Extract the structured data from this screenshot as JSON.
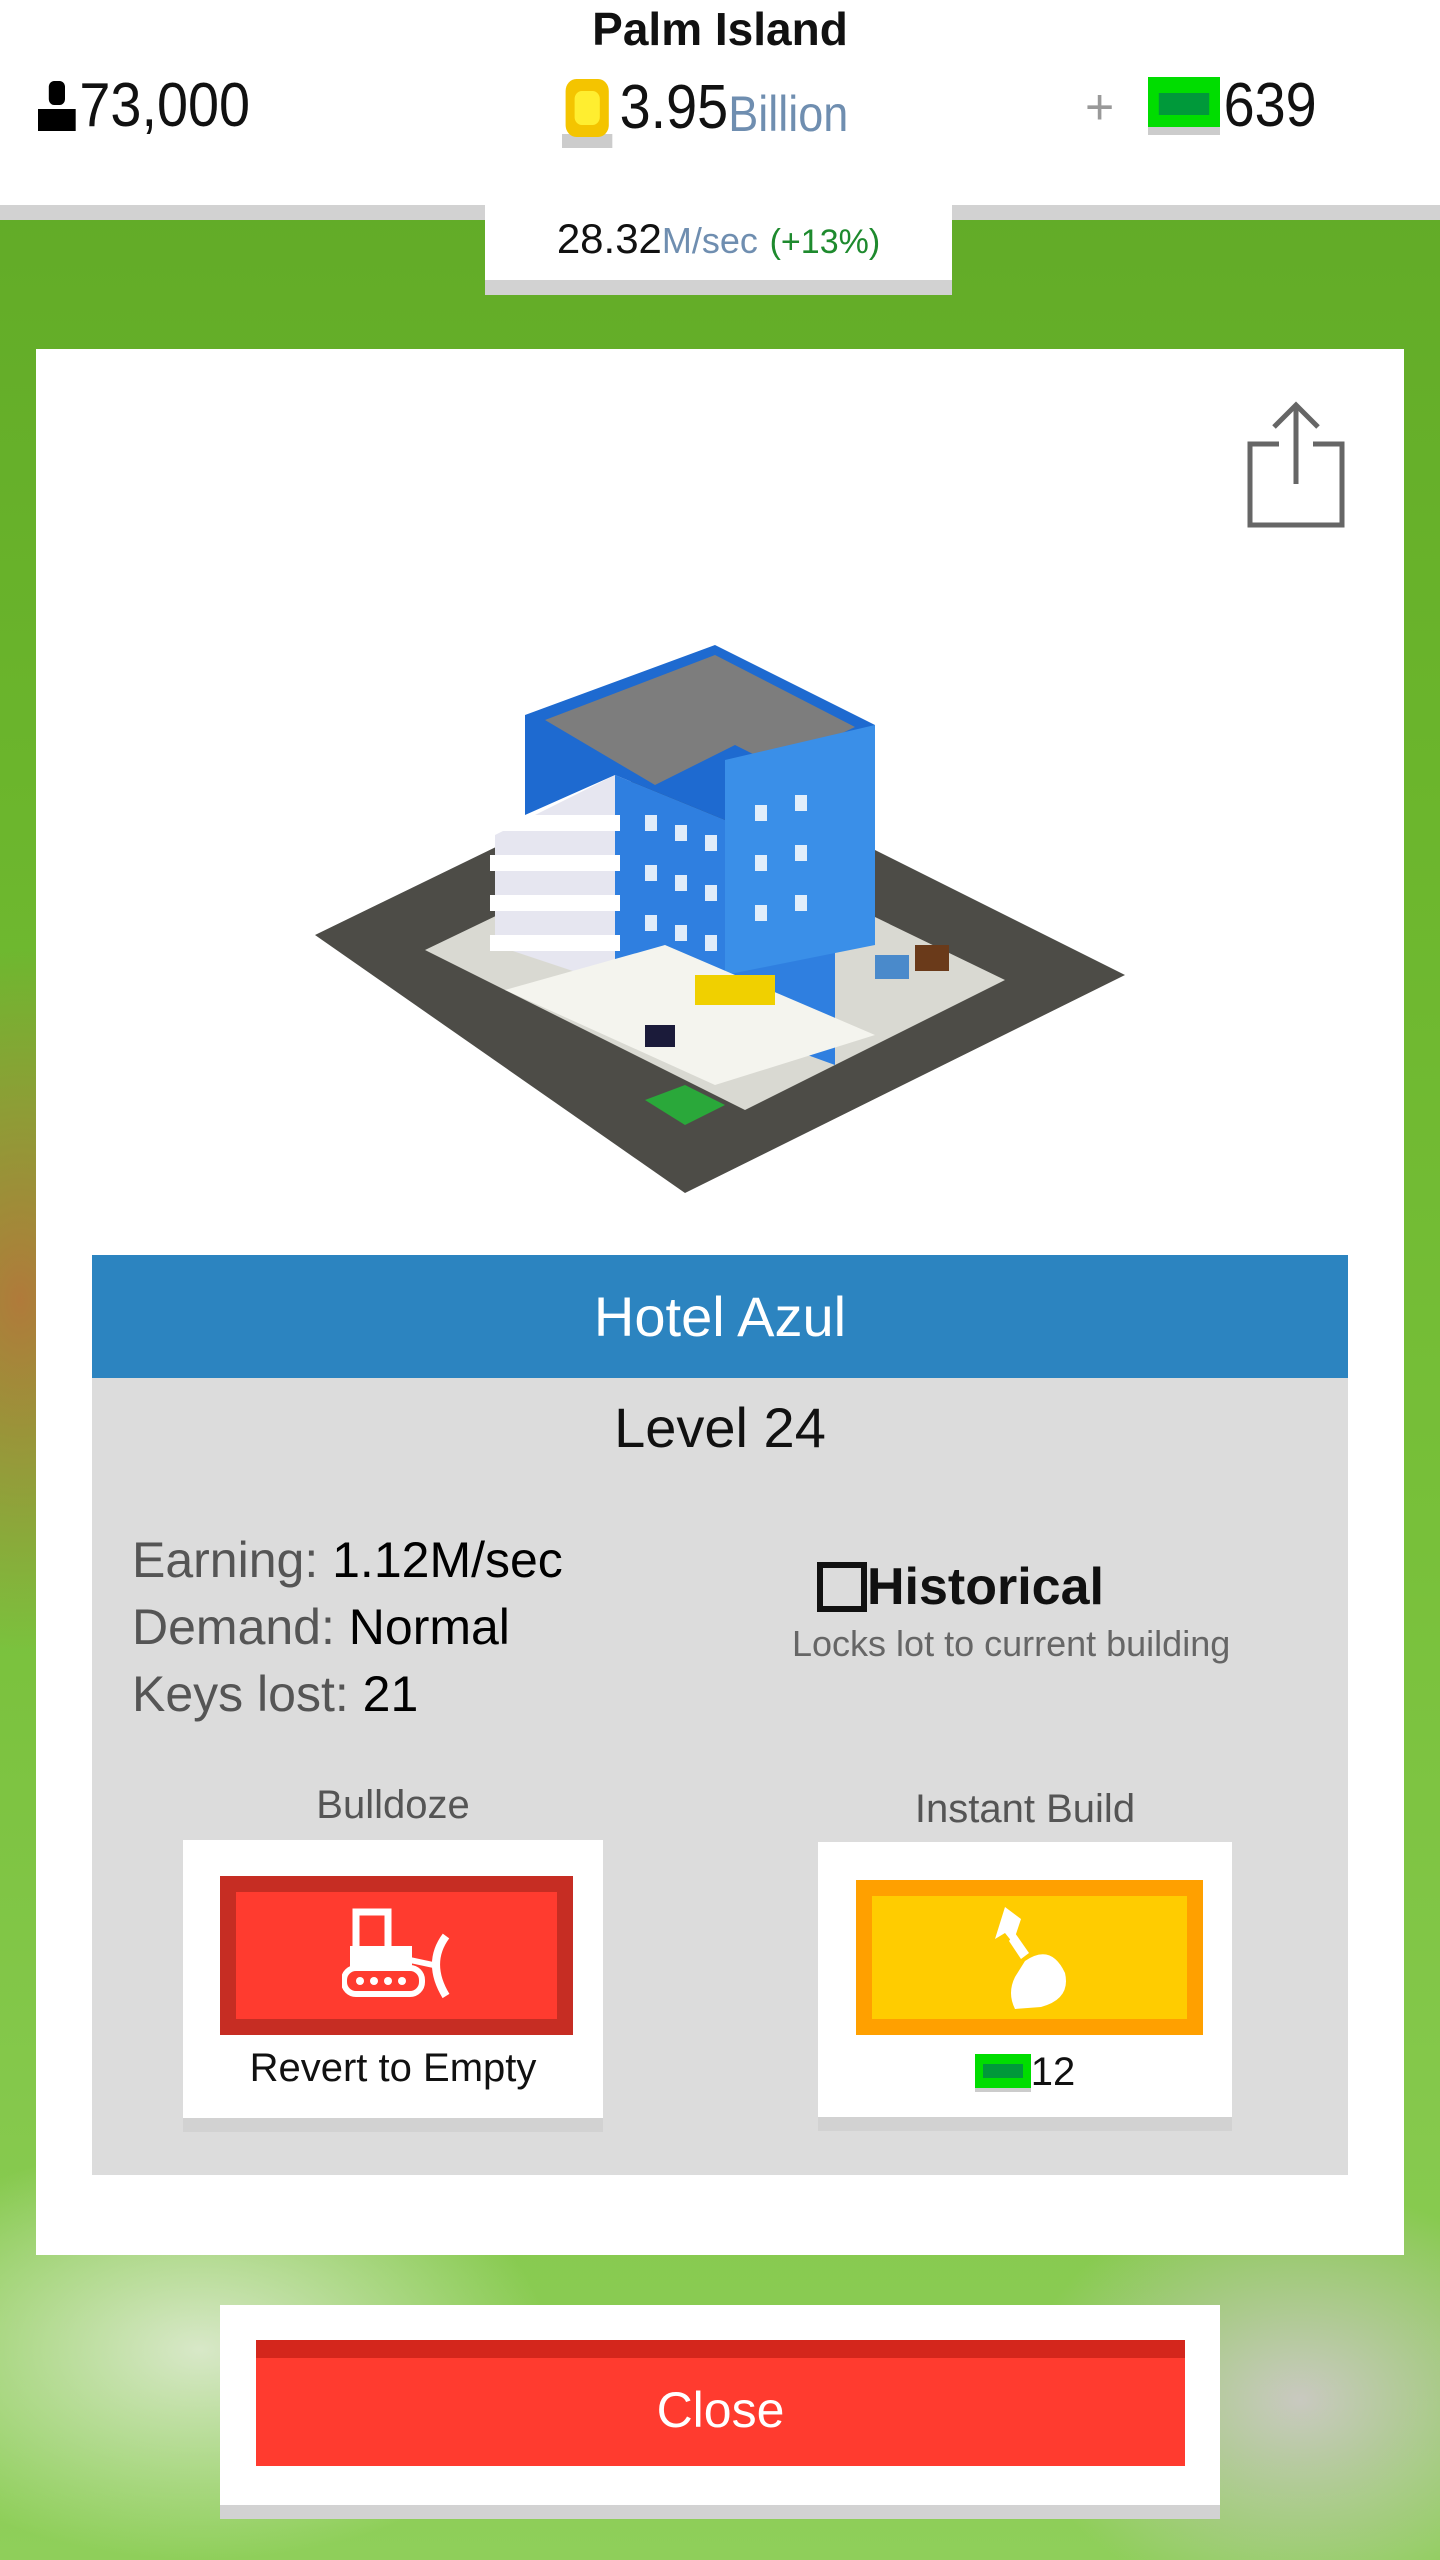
{
  "header": {
    "title": "Palm Island",
    "population": "73,000",
    "coins_value": "3.95",
    "coins_unit": "Billion",
    "plus_label": "+",
    "cash": "639",
    "rate_value": "28.32",
    "rate_unit": "M/sec",
    "rate_bonus": "(+13%)",
    "icons": [
      "person-icon",
      "coin-icon",
      "cash-icon"
    ]
  },
  "modal": {
    "share_icon": "share-icon",
    "building_name": "Hotel Azul",
    "level": "Level 24",
    "stats": [
      {
        "label": "Earning: ",
        "value": "1.12M/sec"
      },
      {
        "label": "Demand: ",
        "value": "Normal"
      },
      {
        "label": "Keys lost: ",
        "value": "21"
      }
    ],
    "historical": {
      "label": "Historical",
      "description": "Locks lot to current building",
      "checked": false
    },
    "bulldoze": {
      "title": "Bulldoze",
      "caption": "Revert to Empty",
      "icon": "bulldozer-icon"
    },
    "instant_build": {
      "title": "Instant Build",
      "cost": "12",
      "icon": "hammer-hand-icon"
    }
  },
  "close_label": "Close",
  "colors": {
    "accent_blue": "#2c84c0",
    "red": "#ff3b2f",
    "yellow": "#ffcc00",
    "cash_green": "#00dd00"
  }
}
